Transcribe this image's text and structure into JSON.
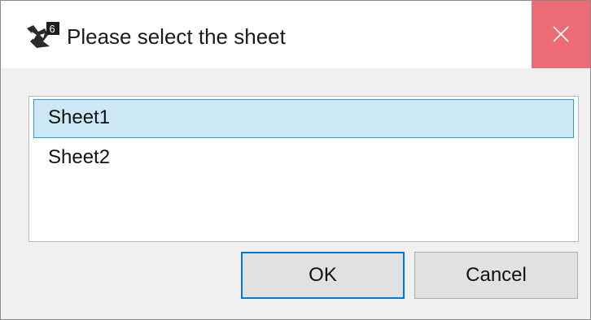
{
  "dialog": {
    "title": "Please select the sheet",
    "icons": {
      "app": "app-icon",
      "close": "close-icon"
    },
    "colors": {
      "close_button_bg": "#ec6b75",
      "selection_bg": "#cce8f5",
      "selection_border": "#26a0da",
      "default_button_border": "#0078d7"
    }
  },
  "sheet_list": {
    "items": [
      {
        "label": "Sheet1",
        "selected": true
      },
      {
        "label": "Sheet2",
        "selected": false
      }
    ]
  },
  "buttons": {
    "ok_label": "OK",
    "cancel_label": "Cancel"
  }
}
